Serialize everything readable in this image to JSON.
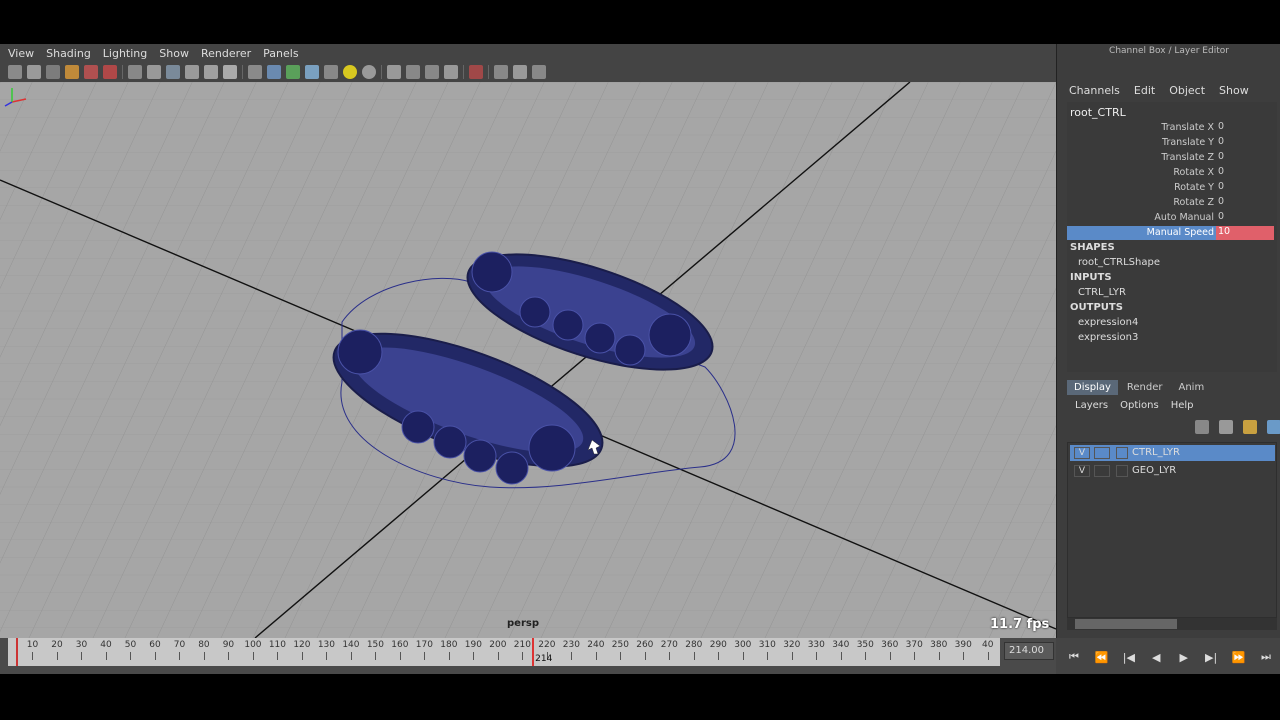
{
  "viewport": {
    "menu": [
      "View",
      "Shading",
      "Lighting",
      "Show",
      "Renderer",
      "Panels"
    ],
    "camera_label": "persp",
    "fps": "11.7 fps"
  },
  "timeline": {
    "ticks": [
      10,
      20,
      30,
      40,
      50,
      60,
      70,
      80,
      90,
      100,
      110,
      120,
      130,
      140,
      150,
      160,
      170,
      180,
      190,
      200,
      210,
      220,
      230,
      240,
      250,
      260,
      270,
      280,
      290,
      300,
      310,
      320,
      330,
      340,
      350,
      360,
      370,
      380,
      390,
      40
    ],
    "current_frame_label": "214",
    "current_frame_field": "214.00"
  },
  "playback": [
    "⏮",
    "⏪",
    "|◀",
    "◀",
    "▶",
    "▶|",
    "⏩",
    "⏭"
  ],
  "channel_box": {
    "title": "Channel Box / Layer Editor",
    "menu": [
      "Channels",
      "Edit",
      "Object",
      "Show"
    ],
    "object_name": "root_CTRL",
    "attributes": [
      {
        "name": "Translate X",
        "value": "0"
      },
      {
        "name": "Translate Y",
        "value": "0"
      },
      {
        "name": "Translate Z",
        "value": "0"
      },
      {
        "name": "Rotate X",
        "value": "0"
      },
      {
        "name": "Rotate Y",
        "value": "0"
      },
      {
        "name": "Rotate Z",
        "value": "0"
      },
      {
        "name": "Auto Manual",
        "value": "0"
      },
      {
        "name": "Manual Speed",
        "value": "10"
      }
    ],
    "shapes_header": "SHAPES",
    "shapes": [
      "root_CTRLShape"
    ],
    "inputs_header": "INPUTS",
    "inputs": [
      "CTRL_LYR"
    ],
    "outputs_header": "OUTPUTS",
    "outputs": [
      "expression4",
      "expression3"
    ]
  },
  "layer_editor": {
    "tabs": [
      "Display",
      "Render",
      "Anim"
    ],
    "menu": [
      "Layers",
      "Options",
      "Help"
    ],
    "layers": [
      {
        "visible": "V",
        "name": "CTRL_LYR"
      },
      {
        "visible": "V",
        "name": "GEO_LYR"
      }
    ]
  },
  "colors": {
    "selection": "#5a8ac8",
    "keyed_value": "#e0606a",
    "wireframe": "#1f2466"
  }
}
